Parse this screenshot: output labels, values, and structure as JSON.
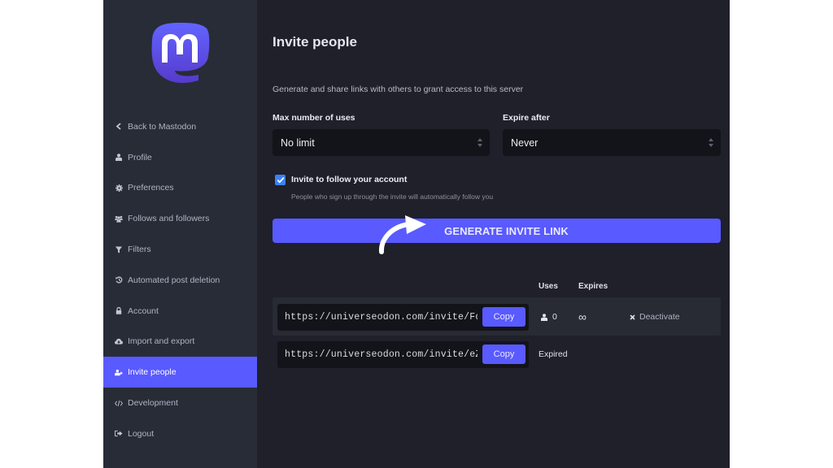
{
  "brand": {
    "name": "Mastodon",
    "accent": "#595aff",
    "logo_icon": "mastodon-logo-icon"
  },
  "sidebar": {
    "items": [
      {
        "label": "Back to Mastodon",
        "icon": "chevron-left-icon",
        "active": false
      },
      {
        "label": "Profile",
        "icon": "user-icon",
        "active": false
      },
      {
        "label": "Preferences",
        "icon": "gear-icon",
        "active": false
      },
      {
        "label": "Follows and followers",
        "icon": "users-icon",
        "active": false
      },
      {
        "label": "Filters",
        "icon": "filter-icon",
        "active": false
      },
      {
        "label": "Automated post deletion",
        "icon": "history-icon",
        "active": false
      },
      {
        "label": "Account",
        "icon": "lock-icon",
        "active": false
      },
      {
        "label": "Import and export",
        "icon": "cloud-icon",
        "active": false
      },
      {
        "label": "Invite people",
        "icon": "user-plus-icon",
        "active": true
      },
      {
        "label": "Development",
        "icon": "code-icon",
        "active": false
      },
      {
        "label": "Logout",
        "icon": "sign-out-icon",
        "active": false
      }
    ]
  },
  "main": {
    "title": "Invite people",
    "description": "Generate and share links with others to grant access to this server",
    "max_uses": {
      "label": "Max number of uses",
      "value": "No limit"
    },
    "expire_after": {
      "label": "Expire after",
      "value": "Never"
    },
    "autofollow": {
      "checked": true,
      "label": "Invite to follow your account",
      "hint": "People who sign up through the invite will automatically follow you"
    },
    "generate_button": "GENERATE INVITE LINK",
    "table": {
      "headers": {
        "uses": "Uses",
        "expires": "Expires"
      },
      "rows": [
        {
          "url": "https://universeodon.com/invite/FdL",
          "copy": "Copy",
          "uses": "0",
          "expires": "∞",
          "action": "Deactivate"
        },
        {
          "url": "https://universeodon.com/invite/eZL",
          "copy": "Copy",
          "status": "Expired"
        }
      ]
    }
  }
}
